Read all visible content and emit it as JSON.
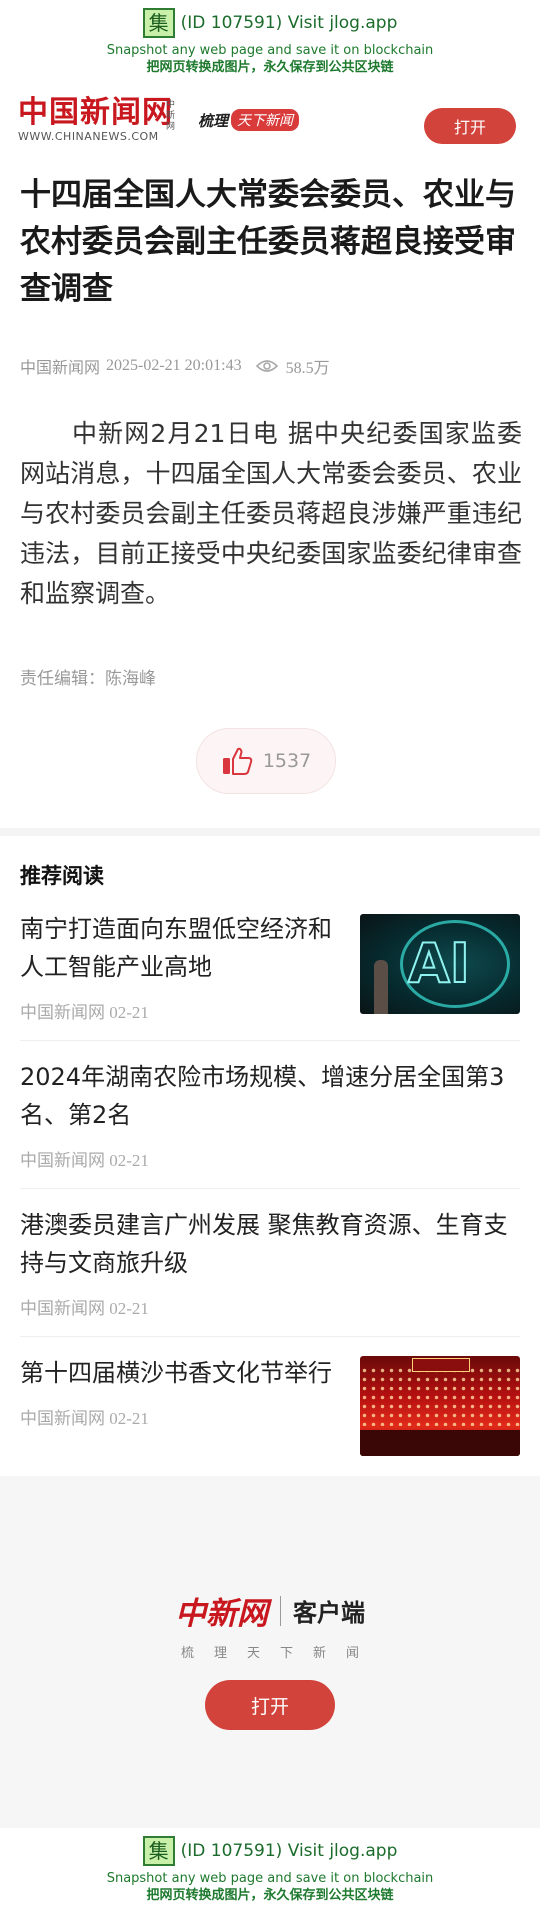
{
  "jlog": {
    "id_text": "(ID 107591) Visit jlog.app",
    "glyph": "集",
    "line2": "Snapshot any web page and save it on blockchain",
    "line3": "把网页转换成图片，永久保存到公共区块链"
  },
  "header": {
    "logo_cn": "中国新闻网",
    "logo_vertical": "中新网",
    "logo_en": "WWW.CHINANEWS.COM",
    "slogan_a": "梳理",
    "slogan_b": "天下新闻",
    "open_label": "打开"
  },
  "article": {
    "title": "十四届全国人大常委会委员、农业与农村委员会副主任委员蒋超良接受审查调查",
    "source": "中国新闻网",
    "datetime": "2025-02-21 20:01:43",
    "views": "58.5万",
    "body": "中新网2月21日电 据中央纪委国家监委网站消息，十四届全国人大常委会委员、农业与农村委员会副主任委员蒋超良涉嫌严重违纪违法，目前正接受中央纪委国家监委纪律审查和监察调查。",
    "editor": "责任编辑：陈海峰",
    "likes": "1537"
  },
  "recommend": {
    "heading": "推荐阅读",
    "items": [
      {
        "title": "南宁打造面向东盟低空经济和人工智能产业高地",
        "meta": "中国新闻网 02-21",
        "thumb_text": "AI"
      },
      {
        "title": "2024年湖南农险市场规模、增速分居全国第3名、第2名",
        "meta": "中国新闻网 02-21"
      },
      {
        "title": "港澳委员建言广州发展 聚焦教育资源、生育支持与文商旅升级",
        "meta": "中国新闻网 02-21"
      },
      {
        "title": "第十四届横沙书香文化节举行",
        "meta": "中国新闻网 02-21"
      }
    ]
  },
  "promo": {
    "brand": "中新网",
    "client": "客户端",
    "tagline": "梳理天下新闻",
    "open_label": "打开"
  },
  "colors": {
    "brand_red": "#c8171e",
    "button_red": "#d2443b",
    "jlog_green": "#1b6b2c"
  }
}
